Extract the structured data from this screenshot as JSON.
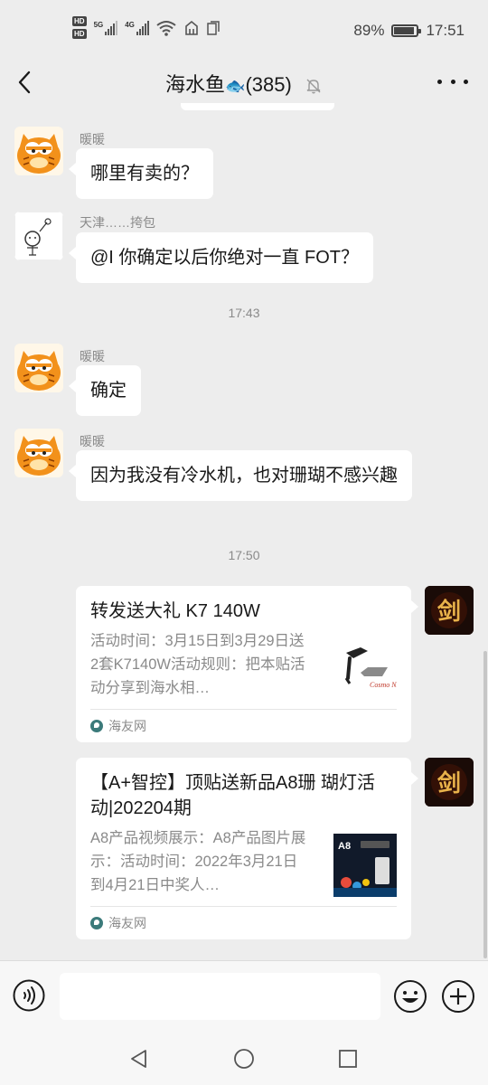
{
  "status_bar": {
    "hd1": "HD",
    "hd2": "HD",
    "net1": "5G",
    "net2": "4G",
    "battery_percent": "89%",
    "battery_level": 0.89,
    "time": "17:51"
  },
  "header": {
    "title": "海水鱼",
    "title_emoji": "🐟",
    "member_count": "(385)",
    "icons": [
      "back-icon",
      "mute-bell-icon",
      "more-icon"
    ]
  },
  "messages": [
    {
      "sender": "暖暖",
      "text": "哪里有卖的？"
    },
    {
      "sender": "天津……挎包",
      "text": "@I  你确定以后你绝对一直 FOT？"
    },
    {
      "sender": "暖暖",
      "text": "确定"
    },
    {
      "sender": "暖暖",
      "text": "因为我没有冷水机，也对珊瑚不感兴趣"
    }
  ],
  "timestamps": [
    "17:43",
    "17:50"
  ],
  "shared_cards": [
    {
      "title": "转发送大礼  K7 140W",
      "description": "活动时间：3月15日到3月29日送2套K7140W活动规则：把本贴活动分享到海水相…",
      "source": "海友网",
      "thumb_text": "Cosmo NP"
    },
    {
      "title": "【A+智控】顶贴送新品A8珊 瑚灯活动|202204期",
      "description": "A8产品视频展示：A8产品图片展示：活动时间：2022年3月21日到4月21日中奖人…",
      "source": "海友网",
      "thumb_text": "A8"
    }
  ],
  "my_avatar_glyph": "剑",
  "input": {
    "placeholder": ""
  },
  "colors": {
    "background": "#ededed",
    "bubble": "#ffffff",
    "secondary_text": "#8a8a8a"
  }
}
